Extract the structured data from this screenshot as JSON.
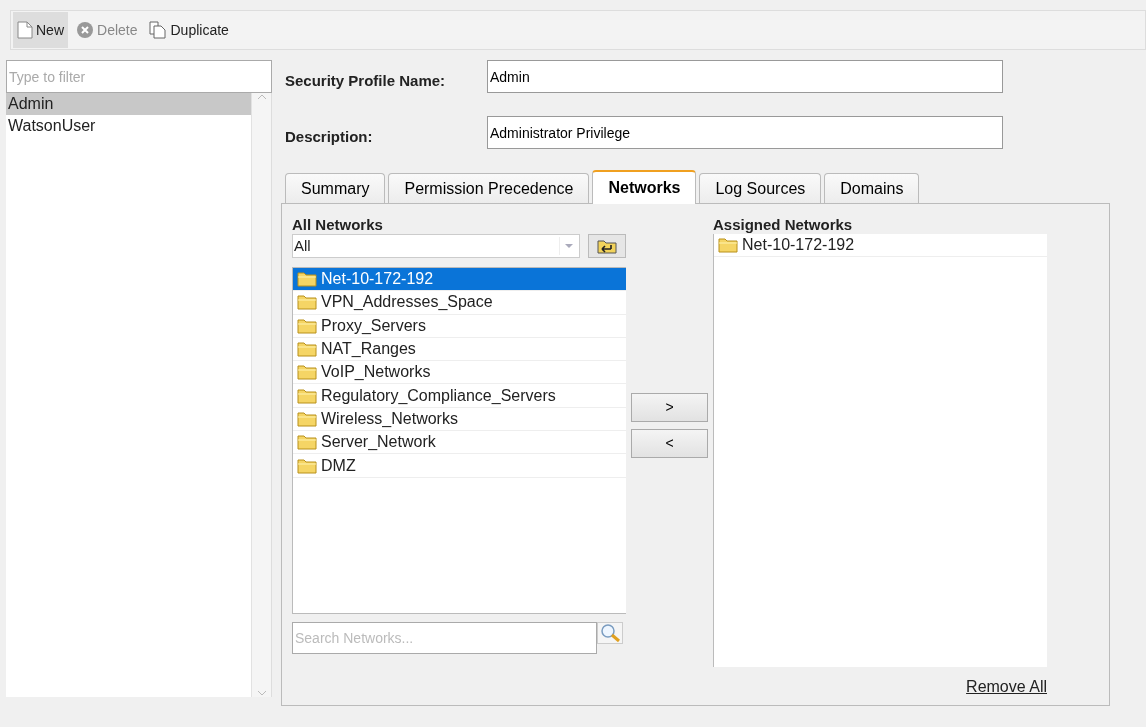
{
  "toolbar": [
    {
      "label": "New",
      "kind": "new",
      "pressed": true,
      "disabled": false
    },
    {
      "label": "Delete",
      "kind": "delete",
      "pressed": false,
      "disabled": true
    },
    {
      "label": "Duplicate",
      "kind": "duplicate",
      "pressed": false,
      "disabled": false
    }
  ],
  "profiles": {
    "placeholder": "Type to filter",
    "items": [
      {
        "label": "Admin",
        "selected": true
      },
      {
        "label": "WatsonUser",
        "selected": false
      }
    ]
  },
  "form": [
    {
      "label": "Security Profile Name:",
      "value": "Admin"
    },
    {
      "label": "Description:",
      "value": "Administrator Privilege"
    }
  ],
  "tabs": [
    {
      "label": "Summary",
      "selected": false
    },
    {
      "label": "Permission Precedence",
      "selected": false
    },
    {
      "label": "Networks",
      "selected": true
    },
    {
      "label": "Log Sources",
      "selected": false
    },
    {
      "label": "Domains",
      "selected": false
    }
  ],
  "all_networks": {
    "title": "All Networks",
    "filter_value": "All",
    "search_placeholder": "Search Networks...",
    "items": [
      {
        "label": "Net-10-172-192",
        "selected": true
      },
      {
        "label": "VPN_Addresses_Space",
        "selected": false
      },
      {
        "label": "Proxy_Servers",
        "selected": false
      },
      {
        "label": "NAT_Ranges",
        "selected": false
      },
      {
        "label": "VoIP_Networks",
        "selected": false
      },
      {
        "label": "Regulatory_Compliance_Servers",
        "selected": false
      },
      {
        "label": "Wireless_Networks",
        "selected": false
      },
      {
        "label": "Server_Network",
        "selected": false
      },
      {
        "label": "DMZ",
        "selected": false
      }
    ]
  },
  "move_buttons": [
    ">",
    "<"
  ],
  "assigned_networks": {
    "title": "Assigned Networks",
    "items": [
      {
        "label": "Net-10-172-192"
      }
    ],
    "remove_all": "Remove All"
  }
}
